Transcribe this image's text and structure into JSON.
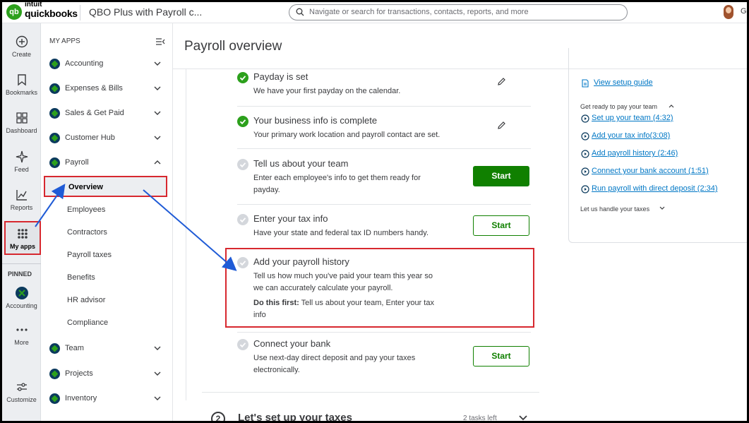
{
  "topbar": {
    "logo_mark": "qb",
    "logo_intuit": "intuit",
    "logo_name": "quickbooks",
    "company": "QBO Plus with Payroll c...",
    "search_placeholder": "Navigate or search for transactions, contacts, reports, and more",
    "user_initial": "G"
  },
  "rail": {
    "items": [
      {
        "label": "Create",
        "icon": "plus-circle-icon"
      },
      {
        "label": "Bookmarks",
        "icon": "bookmark-icon"
      },
      {
        "label": "Dashboard",
        "icon": "dashboard-icon"
      },
      {
        "label": "Feed",
        "icon": "sparkle-icon"
      },
      {
        "label": "Reports",
        "icon": "chart-line-icon"
      },
      {
        "label": "My apps",
        "icon": "grid-dots-icon"
      }
    ],
    "pinned_heading": "PINNED",
    "pinned": [
      {
        "label": "Accounting",
        "icon": "quickbooks-app-icon"
      },
      {
        "label": "More",
        "icon": "more-dots-icon"
      }
    ],
    "customize_label": "Customize"
  },
  "nav": {
    "heading": "MY APPS",
    "apps": [
      {
        "label": "Accounting"
      },
      {
        "label": "Expenses & Bills"
      },
      {
        "label": "Sales & Get Paid"
      },
      {
        "label": "Customer Hub"
      },
      {
        "label": "Payroll"
      }
    ],
    "payroll_sub": [
      {
        "label": "Overview"
      },
      {
        "label": "Employees"
      },
      {
        "label": "Contractors"
      },
      {
        "label": "Payroll taxes"
      },
      {
        "label": "Benefits"
      },
      {
        "label": "HR advisor"
      },
      {
        "label": "Compliance"
      }
    ],
    "apps_after": [
      {
        "label": "Team"
      },
      {
        "label": "Projects"
      },
      {
        "label": "Inventory"
      }
    ]
  },
  "main": {
    "title": "Payroll overview",
    "tasks": [
      {
        "title": "Payday is set",
        "desc": "We have your first payday on the calendar.",
        "status": "done"
      },
      {
        "title": "Your business info is complete",
        "desc": "Your primary work location and payroll contact are set.",
        "status": "done"
      },
      {
        "title": "Tell us about your team",
        "desc1": "Enter each employee's info to get them ready for",
        "desc2": "payday.",
        "button": "Start",
        "status": "todo"
      },
      {
        "title": "Enter your tax info",
        "desc": "Have your state and federal tax ID numbers handy.",
        "button": "Start",
        "status": "todo"
      },
      {
        "title": "Add your payroll history",
        "desc1": "Tell us how much you've paid your team this year so",
        "desc2": "we can accurately calculate your payroll.",
        "prereq_label": "Do this first:",
        "prereq1": " Tell us about your team, Enter your tax",
        "prereq2": "info",
        "status": "locked"
      },
      {
        "title": "Connect your bank",
        "desc1": "Use next-day direct deposit and pay your taxes",
        "desc2": "electronically.",
        "button": "Start",
        "status": "todo"
      }
    ],
    "next_section": {
      "number": "2",
      "title": "Let's set up your taxes",
      "count": "2 tasks left"
    }
  },
  "right_panel": {
    "setup_guide": "View setup guide",
    "pay_team_heading": "Get ready to pay your team",
    "videos": [
      "Set up your team (4:32)",
      "Add your tax info(3:08)",
      "Add payroll history (2:46)",
      "Connect your bank account (1:51)",
      "Run payroll with direct deposit (2:34)"
    ],
    "taxes_heading": "Let us handle your taxes"
  },
  "colors": {
    "brand_green": "#2ca01c",
    "button_green": "#108000",
    "link_blue": "#0077c5",
    "highlight_red": "#d7282f",
    "arrow_blue": "#1f5bd6"
  }
}
